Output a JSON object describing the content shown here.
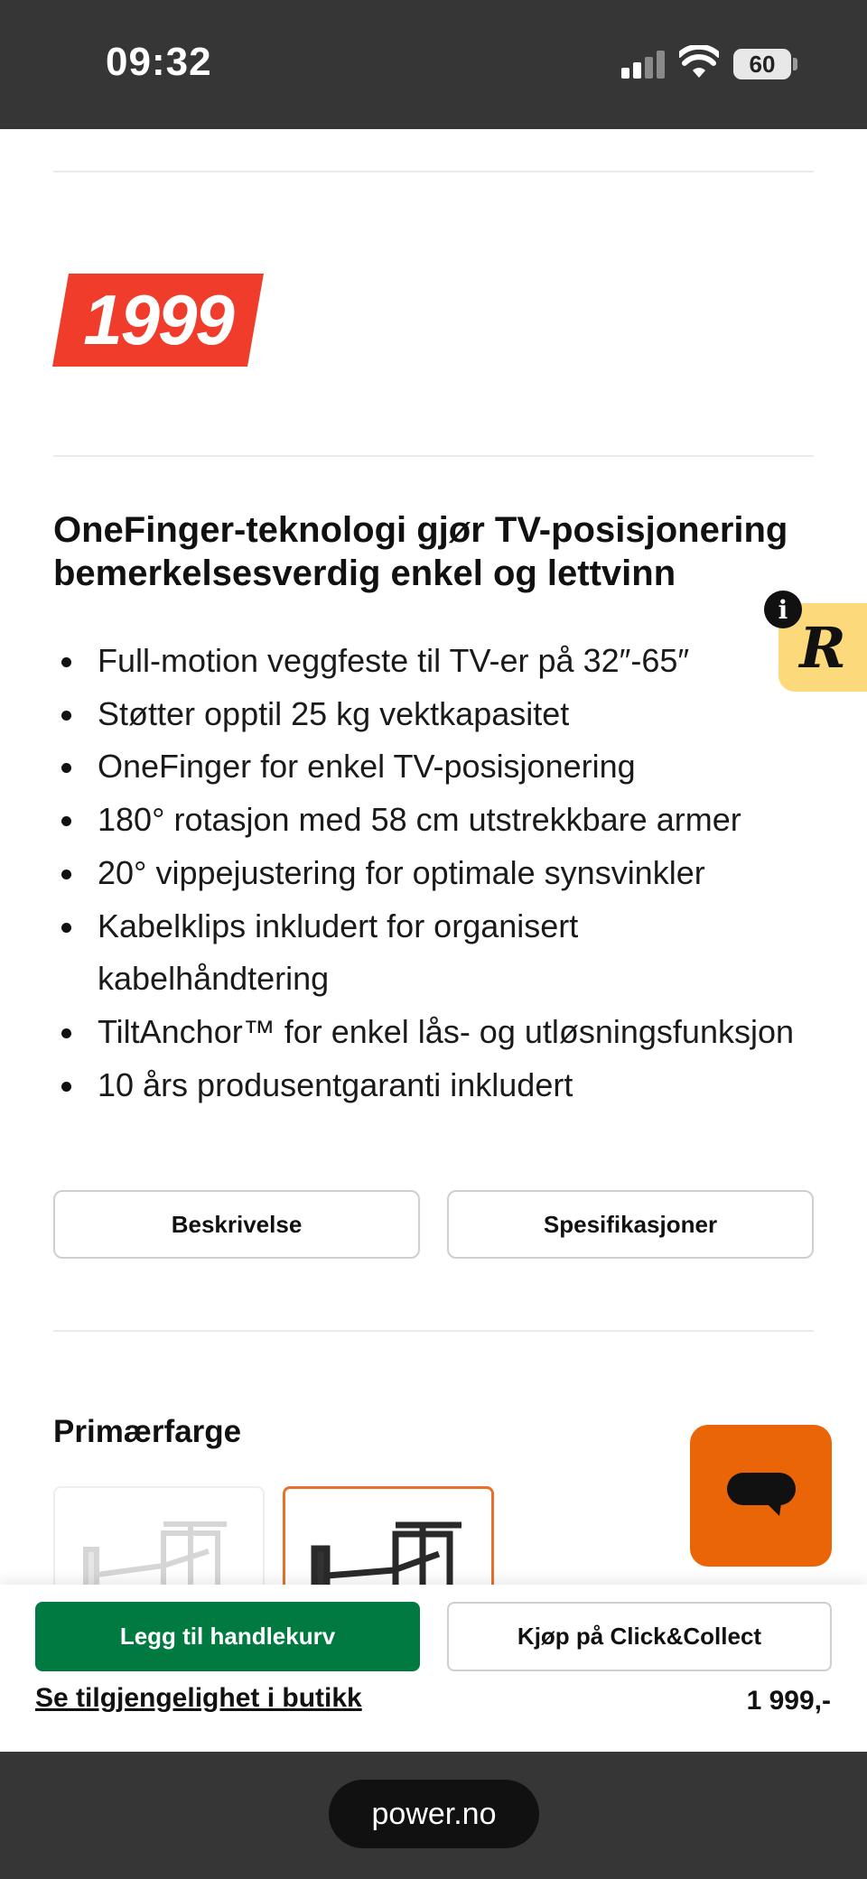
{
  "status_bar": {
    "time": "09:32",
    "battery": "60"
  },
  "product": {
    "price_badge": "1999",
    "headline": "OneFinger-teknologi gjør TV-posisjonering bemerkelsesverdig enkel og lettvinn",
    "features": [
      "Full-motion veggfeste til TV-er på 32″-65″",
      "Støtter opptil 25 kg vektkapasitet",
      "OneFinger for enkel TV-posisjonering",
      "180° rotasjon med 58 cm utstrekkbare armer",
      "20° vippejustering for optimale synsvinkler",
      "Kabelklips inkludert for organisert kabelhåndtering",
      "TiltAnchor™ for enkel lås- og utløsningsfunksjon",
      "10 års produsentgaranti inkludert"
    ],
    "tabs": {
      "description": "Beskrivelse",
      "specifications": "Spesifikasjoner"
    },
    "color_section_title": "Primærfarge",
    "color_options": [
      {
        "icon": "white-tv-mount",
        "selected": false
      },
      {
        "icon": "black-tv-mount",
        "selected": true
      }
    ]
  },
  "overlays": {
    "r_badge_letter": "R",
    "info_letter": "i",
    "chat_icon": "chat-bubble-icon"
  },
  "sticky_bar": {
    "add_to_cart": "Legg til handlekurv",
    "click_collect": "Kjøp på Click&Collect",
    "store_availability": "Se tilgjengelighet i butikk",
    "price": "1 999,-"
  },
  "browser": {
    "url": "power.no"
  },
  "colors": {
    "status_bg": "#363636",
    "price_badge": "#f03c2a",
    "cart_button": "#007a40",
    "chat_button": "#ea6507",
    "r_badge": "#fcd97a",
    "selected_swatch_border": "#e8702a"
  }
}
